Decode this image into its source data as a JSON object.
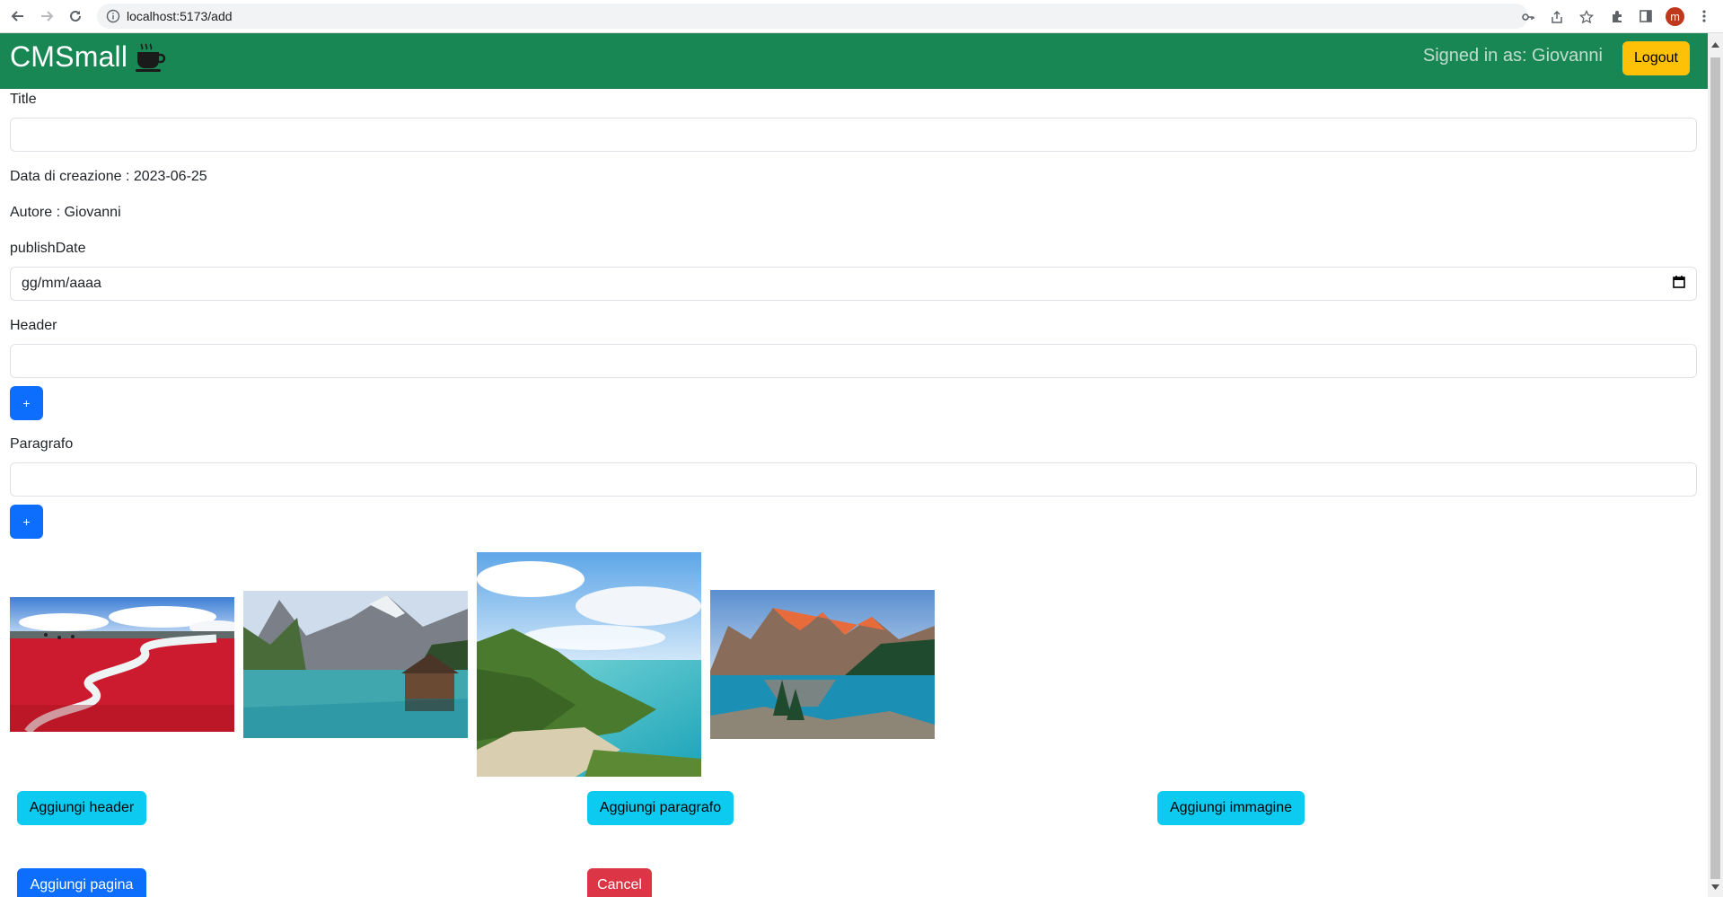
{
  "browser": {
    "url": "localhost:5173/add",
    "profile_initial": "m"
  },
  "navbar": {
    "brand": "CMSmall",
    "signed_in_text": "Signed in as: Giovanni",
    "logout_label": "Logout"
  },
  "form": {
    "title_label": "Title",
    "title_value": "",
    "creation_date_text": "Data di creazione : 2023-06-25",
    "author_text": "Autore : Giovanni",
    "publish_date_label": "publishDate",
    "publish_date_placeholder": "gg/mm/aaaa",
    "header_label": "Header",
    "header_value": "",
    "header_add_label": "+",
    "paragraph_label": "Paragrafo",
    "paragraph_value": "",
    "paragraph_add_label": "+"
  },
  "images": [
    {
      "name": "red-beach-image",
      "desc": "red marsh with winding river"
    },
    {
      "name": "alpine-lake-image",
      "desc": "mountain lake with wooden house"
    },
    {
      "name": "coastal-bay-image",
      "desc": "green coast and turquoise sea"
    },
    {
      "name": "moraine-lake-image",
      "desc": "mountain lake at sunrise"
    }
  ],
  "actions": {
    "add_header": "Aggiungi header",
    "add_paragraph": "Aggiungi paragrafo",
    "add_image": "Aggiungi immagine",
    "add_page": "Aggiungi pagina",
    "cancel": "Cancel"
  },
  "colors": {
    "navbar": "#198754",
    "warning": "#ffc107",
    "primary": "#0d6efd",
    "info": "#0dcaf0",
    "danger": "#dc3545"
  }
}
